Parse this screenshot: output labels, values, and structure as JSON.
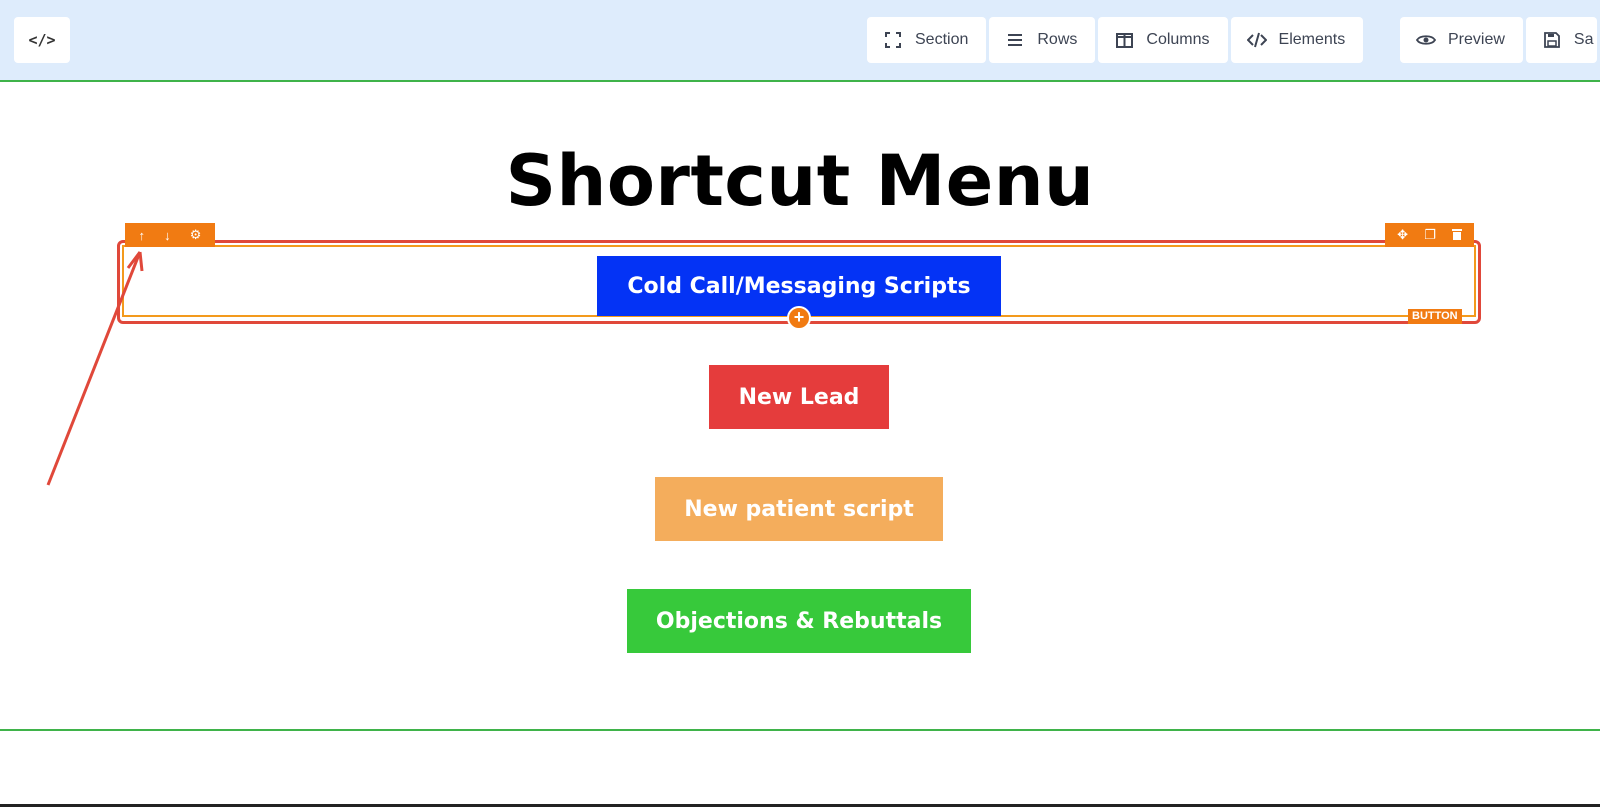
{
  "toolbar": {
    "code_icon_glyph": "</>",
    "items": [
      {
        "label": "Section",
        "icon": "section-icon"
      },
      {
        "label": "Rows",
        "icon": "rows-icon"
      },
      {
        "label": "Columns",
        "icon": "columns-icon"
      },
      {
        "label": "Elements",
        "icon": "elements-icon"
      }
    ],
    "preview_label": "Preview",
    "save_label": "Sa"
  },
  "page": {
    "title": "Shortcut Menu"
  },
  "selection": {
    "up_glyph": "↑",
    "down_glyph": "↓",
    "settings_glyph": "⚙",
    "move_glyph": "✥",
    "copy_glyph": "❐",
    "delete_glyph": "🗑",
    "element_tag": "BUTTON",
    "add_glyph": "+"
  },
  "buttons": [
    {
      "label": "Cold Call/Messaging Scripts",
      "color": "#0433f5"
    },
    {
      "label": "New Lead",
      "color": "#e53c3c"
    },
    {
      "label": "New patient script",
      "color": "#f4ad5c"
    },
    {
      "label": "Objections & Rebuttals",
      "color": "#37c93b"
    }
  ],
  "colors": {
    "topbar_bg": "#deecfc",
    "divider_green": "#3fb34a",
    "selection_orange": "#f17b12",
    "selection_red": "#e0483a"
  }
}
